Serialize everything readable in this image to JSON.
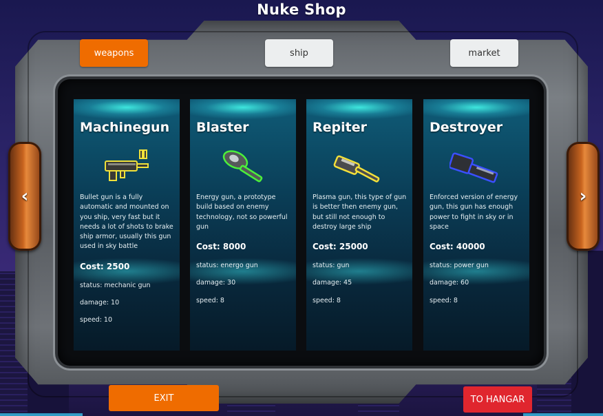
{
  "title": "Nuke Shop",
  "tabs": [
    {
      "label": "weapons",
      "active": true
    },
    {
      "label": "ship",
      "active": false
    },
    {
      "label": "market",
      "active": false
    }
  ],
  "nav": {
    "prev_glyph": "‹",
    "next_glyph": "›"
  },
  "cards": [
    {
      "name": "Machinegun",
      "icon": "machinegun-icon",
      "description": "Bullet gun is a fully automatic and mounted on you ship, very fast but it needs a lot of shots to brake ship armor, usually this gun used in sky battle",
      "cost": "Cost: 2500",
      "status": "status: mechanic gun",
      "damage": "damage: 10",
      "speed": "speed: 10"
    },
    {
      "name": "Blaster",
      "icon": "blaster-icon",
      "description": "Energy gun, a prototype build based on enemy technology, not so powerful gun",
      "cost": "Cost: 8000",
      "status": "status: energo gun",
      "damage": "damage: 30",
      "speed": "speed: 8"
    },
    {
      "name": "Repiter",
      "icon": "repiter-icon",
      "description": "Plasma gun, this type of gun is better then enemy gun, but still not enough to destroy large ship",
      "cost": "Cost: 25000",
      "status": "status: gun",
      "damage": "damage: 45",
      "speed": "speed: 8"
    },
    {
      "name": "Destroyer",
      "icon": "destroyer-icon",
      "description": "Enforced version of energy gun, this gun has enough power to fight in sky or in space",
      "cost": "Cost: 40000",
      "status": "status: power gun",
      "damage": "damage: 60",
      "speed": "speed: 8"
    }
  ],
  "buttons": {
    "exit": "EXIT",
    "hangar": "TO HANGAR"
  },
  "colors": {
    "accent": "#ef6c00",
    "hangar": "#e0262e",
    "tab_inactive": "#eceeef"
  }
}
